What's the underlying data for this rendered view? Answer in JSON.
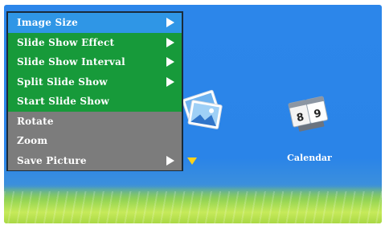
{
  "menu": {
    "items": [
      {
        "label": "Image Size",
        "has_submenu": true,
        "state": "selected"
      },
      {
        "label": "Slide Show Effect",
        "has_submenu": true,
        "state": "enabled"
      },
      {
        "label": "Slide Show Interval",
        "has_submenu": true,
        "state": "enabled"
      },
      {
        "label": "Split Slide Show",
        "has_submenu": true,
        "state": "enabled"
      },
      {
        "label": "Start Slide Show",
        "has_submenu": false,
        "state": "enabled"
      },
      {
        "label": "Rotate",
        "has_submenu": false,
        "state": "disabled"
      },
      {
        "label": "Zoom",
        "has_submenu": false,
        "state": "disabled"
      },
      {
        "label": "Save Picture",
        "has_submenu": true,
        "state": "disabled"
      }
    ]
  },
  "desktop": {
    "icons": [
      {
        "name": "photo",
        "label": ""
      },
      {
        "name": "calendar",
        "label": "Calendar"
      }
    ],
    "calendar_digits": [
      "8",
      "9"
    ]
  },
  "colors": {
    "selected": "#2f96e6",
    "enabled": "#179a3a",
    "disabled": "#7c7c7c",
    "marker": "#ffd21a"
  }
}
